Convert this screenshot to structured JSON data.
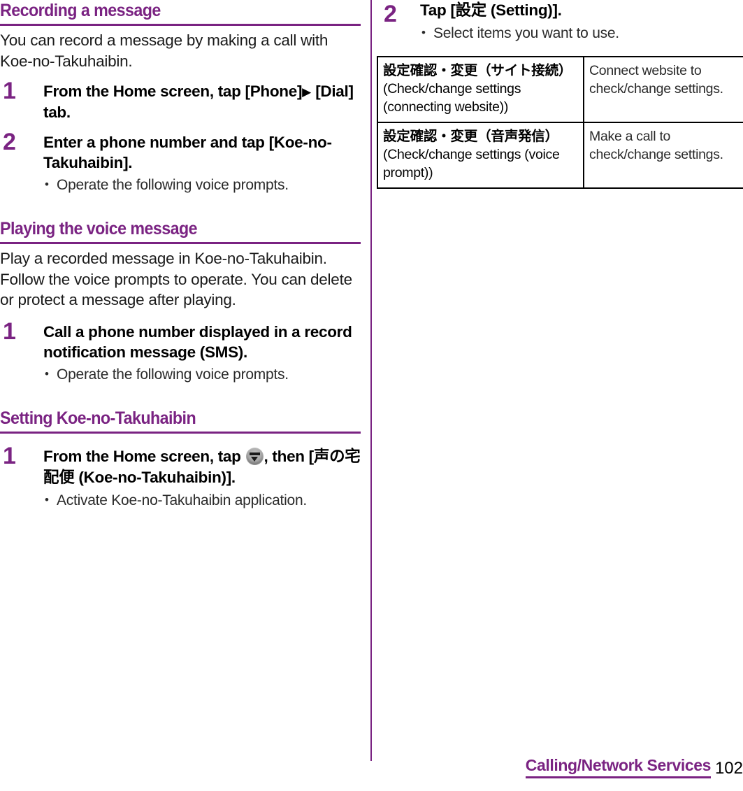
{
  "page": {
    "number": "102",
    "chapter": "Calling/Network Services",
    "accent_color": "#7A2382",
    "text_color": "#000000"
  },
  "left_column": {
    "sections": [
      {
        "heading": "Recording a message",
        "intro": "You can record a message by making a call with Koe-no-Takuhaibin.",
        "steps": [
          {
            "number": "1",
            "title_pre": "From the Home screen, tap [Phone]",
            "title_triangle": "▶",
            "title_post": "[Dial] tab.",
            "notes": []
          },
          {
            "number": "2",
            "title_pre": "Enter a phone number and tap [Koe-no-Takuhaibin].",
            "title_triangle": "",
            "title_post": "",
            "notes": [
              "Operate the following voice prompts."
            ]
          }
        ]
      },
      {
        "heading": "Playing the voice message",
        "intro": "Play a recorded message in Koe-no-Takuhaibin. Follow the voice prompts to operate. You can delete or protect a message after playing.",
        "steps": [
          {
            "number": "1",
            "title_pre": "Call a phone number displayed in a record notification message (SMS).",
            "title_triangle": "",
            "title_post": "",
            "notes": [
              "Operate the following voice prompts."
            ]
          }
        ]
      },
      {
        "heading": "Setting Koe-no-Takuhaibin",
        "intro": "",
        "steps": [
          {
            "number": "1",
            "title_pre": "From the Home screen, tap ",
            "icon": "app-drawer-icon",
            "title_mid": ", then [",
            "title_jp": "声の宅配便",
            "title_post": " (Koe-no-Takuhaibin)].",
            "notes": [
              "Activate Koe-no-Takuhaibin application."
            ]
          }
        ]
      }
    ]
  },
  "right_column": {
    "step": {
      "number": "2",
      "title_pre": "Tap [",
      "title_jp": "設定",
      "title_post": " (Setting)].",
      "notes": [
        "Select items you want to use."
      ]
    },
    "table": {
      "rows": [
        {
          "label_jp": "設定確認・変更（サイト接続）",
          "label_en": "(Check/change settings (connecting website))",
          "description": "Connect website to check/change settings."
        },
        {
          "label_jp": "設定確認・変更（音声発信）",
          "label_en": "(Check/change settings (voice prompt))",
          "description": "Make a call to check/change settings."
        }
      ]
    }
  }
}
